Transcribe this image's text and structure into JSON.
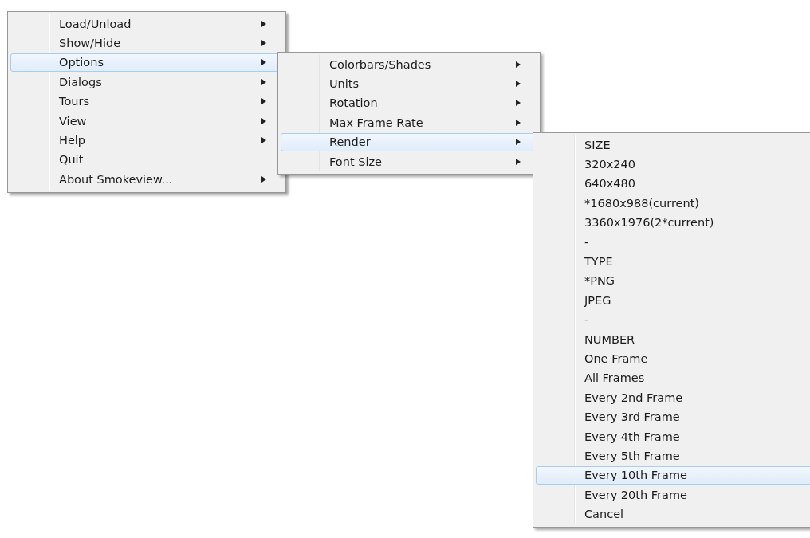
{
  "menus": [
    {
      "items": [
        {
          "label": "Load/Unload",
          "submenu": true,
          "selected": false
        },
        {
          "label": "Show/Hide",
          "submenu": true,
          "selected": false
        },
        {
          "label": "Options",
          "submenu": true,
          "selected": true
        },
        {
          "label": "Dialogs",
          "submenu": true,
          "selected": false
        },
        {
          "label": "Tours",
          "submenu": true,
          "selected": false
        },
        {
          "label": "View",
          "submenu": true,
          "selected": false
        },
        {
          "label": "Help",
          "submenu": true,
          "selected": false
        },
        {
          "label": "Quit",
          "submenu": false,
          "selected": false
        },
        {
          "label": "About Smokeview...",
          "submenu": true,
          "selected": false
        }
      ]
    },
    {
      "items": [
        {
          "label": "Colorbars/Shades",
          "submenu": true,
          "selected": false
        },
        {
          "label": "Units",
          "submenu": true,
          "selected": false
        },
        {
          "label": "Rotation",
          "submenu": true,
          "selected": false
        },
        {
          "label": "Max Frame Rate",
          "submenu": true,
          "selected": false
        },
        {
          "label": "Render",
          "submenu": true,
          "selected": true
        },
        {
          "label": "Font Size",
          "submenu": true,
          "selected": false
        }
      ]
    },
    {
      "items": [
        {
          "label": "SIZE",
          "submenu": false,
          "selected": false
        },
        {
          "label": "320x240",
          "submenu": false,
          "selected": false
        },
        {
          "label": "640x480",
          "submenu": false,
          "selected": false
        },
        {
          "label": "*1680x988(current)",
          "submenu": false,
          "selected": false
        },
        {
          "label": "3360x1976(2*current)",
          "submenu": false,
          "selected": false
        },
        {
          "label": "-",
          "submenu": false,
          "selected": false
        },
        {
          "label": "TYPE",
          "submenu": false,
          "selected": false
        },
        {
          "label": "*PNG",
          "submenu": false,
          "selected": false
        },
        {
          "label": "JPEG",
          "submenu": false,
          "selected": false
        },
        {
          "label": "-",
          "submenu": false,
          "selected": false
        },
        {
          "label": "NUMBER",
          "submenu": false,
          "selected": false
        },
        {
          "label": "One Frame",
          "submenu": false,
          "selected": false
        },
        {
          "label": "All Frames",
          "submenu": false,
          "selected": false
        },
        {
          "label": "Every 2nd Frame",
          "submenu": false,
          "selected": false
        },
        {
          "label": "Every 3rd Frame",
          "submenu": false,
          "selected": false
        },
        {
          "label": "Every 4th Frame",
          "submenu": false,
          "selected": false
        },
        {
          "label": "Every 5th Frame",
          "submenu": false,
          "selected": false
        },
        {
          "label": "Every 10th Frame",
          "submenu": false,
          "selected": true
        },
        {
          "label": "Every 20th Frame",
          "submenu": false,
          "selected": false
        },
        {
          "label": "Cancel",
          "submenu": false,
          "selected": false
        }
      ]
    }
  ]
}
